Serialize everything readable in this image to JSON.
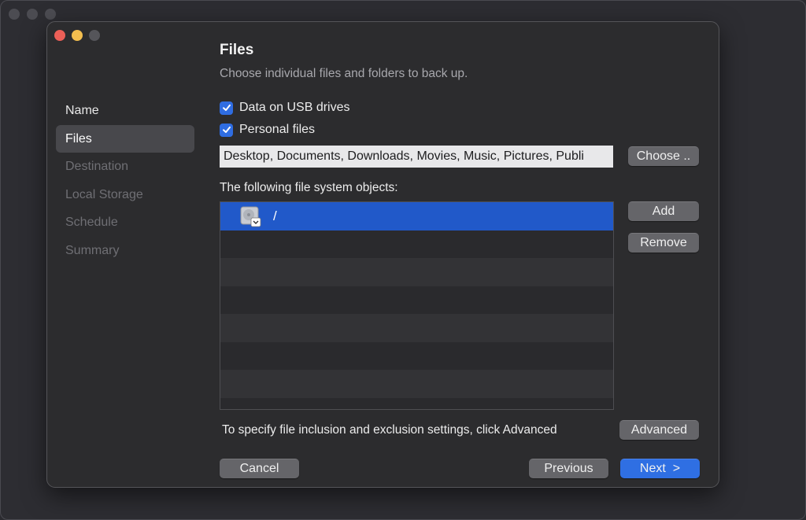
{
  "dialog": {
    "title": "Files",
    "subtitle": "Choose individual files and folders to back up."
  },
  "sidebar": {
    "items": [
      {
        "label": "Name",
        "state": "done"
      },
      {
        "label": "Files",
        "state": "active"
      },
      {
        "label": "Destination",
        "state": "pending"
      },
      {
        "label": "Local Storage",
        "state": "pending"
      },
      {
        "label": "Schedule",
        "state": "pending"
      },
      {
        "label": "Summary",
        "state": "pending"
      }
    ]
  },
  "options": {
    "usb_label": "Data on USB drives",
    "usb_checked": true,
    "personal_label": "Personal files",
    "personal_checked": true,
    "personal_paths": "Desktop, Documents, Downloads, Movies, Music, Pictures, Publi",
    "choose_label": "Choose .."
  },
  "objects": {
    "label": "The following file system objects:",
    "items": [
      {
        "name": "/",
        "icon": "hard-drive-icon",
        "selected": true
      }
    ],
    "add_label": "Add",
    "remove_label": "Remove"
  },
  "advanced": {
    "text": "To specify file inclusion and exclusion settings, click Advanced",
    "button_label": "Advanced"
  },
  "footer": {
    "cancel_label": "Cancel",
    "previous_label": "Previous",
    "next_label": "Next  >"
  },
  "colors": {
    "accent": "#2f6fe3",
    "selection": "#2159c9",
    "close": "#ec5f57",
    "minimize": "#f3be4f"
  }
}
